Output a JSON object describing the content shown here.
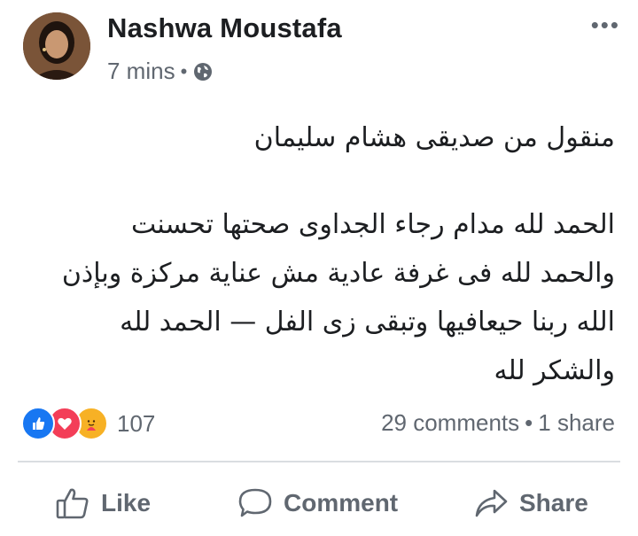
{
  "post": {
    "author": "Nashwa Moustafa",
    "time": "7 mins",
    "separator": "•",
    "privacy_icon": "globe-icon",
    "more_icon": "more-options-icon",
    "more_glyph": "•••",
    "text_line1": "منقول من صديقى هشام سليمان",
    "text_para2": [
      "الحمد لله مدام رجاء الجداوى صحتها تحسنت",
      "والحمد لله فى غرفة عادية مش عناية مركزة وبإذن",
      "الله ربنا حيعافيها وتبقى زى الفل — الحمد لله",
      "والشكر لله"
    ]
  },
  "reactions": {
    "icons": [
      "like-icon",
      "love-icon",
      "care-icon"
    ],
    "count": "107",
    "comments": "29 comments",
    "separator": "•",
    "shares": "1 share"
  },
  "actions": {
    "like": "Like",
    "comment": "Comment",
    "share": "Share"
  },
  "colors": {
    "text": "#1c1e21",
    "secondary": "#606770",
    "like_blue": "#1877f2",
    "love_red": "#f33e58",
    "care_yellow": "#f7b125",
    "divider": "#dadde1"
  }
}
